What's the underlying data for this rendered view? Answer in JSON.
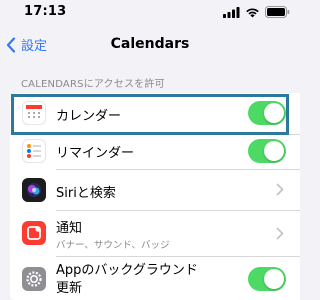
{
  "status_bar": {
    "time": "17:13",
    "icons": [
      "signal-icon",
      "wifi-icon",
      "battery-icon"
    ]
  },
  "nav": {
    "back_label": "設定",
    "title": "Calendars"
  },
  "section": {
    "header": "CALENDARSにアクセスを許可"
  },
  "rows": [
    {
      "label": "カレンダー",
      "icon": "calendar-app-icon",
      "control": "toggle",
      "on": true
    },
    {
      "label": "リマインダー",
      "icon": "reminders-app-icon",
      "control": "toggle",
      "on": true
    },
    {
      "label": "Siriと検索",
      "icon": "siri-app-icon",
      "control": "chevron"
    },
    {
      "label": "通知",
      "sublabel": "バナー、サウンド、バッジ",
      "icon": "notifications-app-icon",
      "control": "chevron"
    },
    {
      "label": "Appのバックグラウンド",
      "label_line2": "更新",
      "icon": "settings-gear-app-icon",
      "control": "toggle",
      "on": true
    }
  ],
  "colors": {
    "accent_blue": "#3478f6",
    "toggle_on": "#4cd964",
    "highlight_border": "#2b7a9c",
    "background": "#f2f2f7"
  }
}
